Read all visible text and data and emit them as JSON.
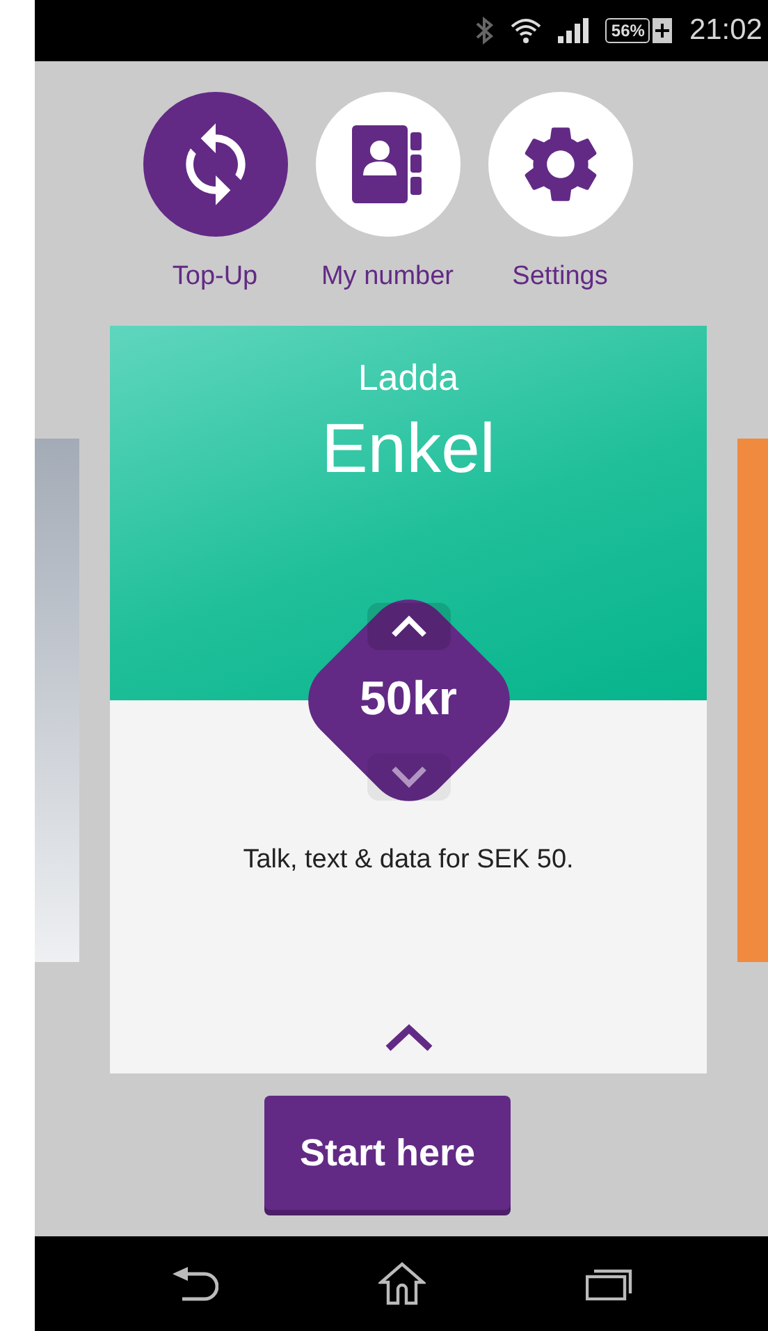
{
  "status_bar": {
    "battery": "56%",
    "time": "21:02"
  },
  "shortcuts": [
    {
      "label": "Top-Up",
      "kind": "topup",
      "selected": true
    },
    {
      "label": "My number",
      "kind": "contacts",
      "selected": false
    },
    {
      "label": "Settings",
      "kind": "settings",
      "selected": false
    }
  ],
  "side_cards": [
    {
      "color": "#a3abb6"
    },
    {
      "color": "#ef8a3f"
    }
  ],
  "card": {
    "subtitle": "Ladda",
    "title": "Enkel",
    "amount": "50kr",
    "up_disabled": false,
    "down_disabled": true,
    "description": "Talk, text & data for SEK 50."
  },
  "primary_button": "Start here"
}
